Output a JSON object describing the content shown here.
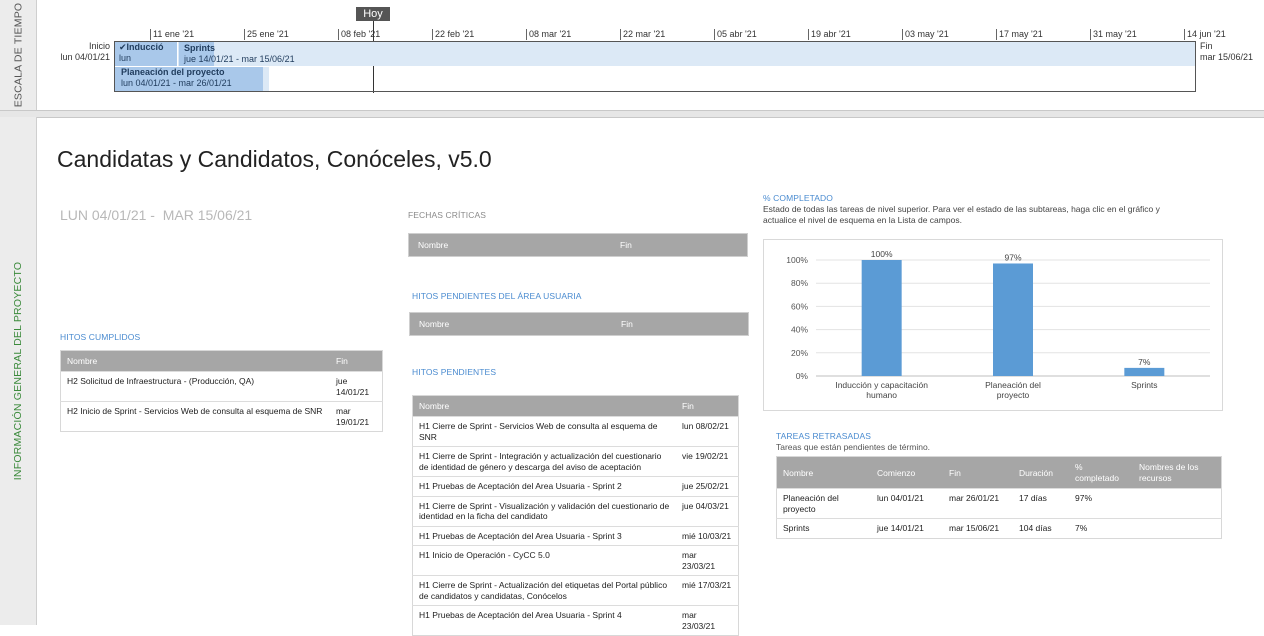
{
  "timeline": {
    "side_label": "ESCALA DE TIEMPO",
    "today_label": "Hoy",
    "ticks": [
      "11 ene '21",
      "25 ene '21",
      "08 feb '21",
      "22 feb '21",
      "08 mar '21",
      "22 mar '21",
      "05 abr '21",
      "19 abr '21",
      "03 may '21",
      "17 may '21",
      "31 may '21",
      "14 jun '21"
    ],
    "start_label": "Inicio",
    "start_date": "lun 04/01/21",
    "end_label": "Fin",
    "end_date": "mar 15/06/21",
    "bars": [
      {
        "name": "✔Inducció",
        "date": "lun"
      },
      {
        "name": "Sprints",
        "date": "jue 14/01/21 - mar 15/06/21"
      },
      {
        "name": "Planeación del proyecto",
        "date": "lun 04/01/21 - mar 26/01/21"
      }
    ]
  },
  "overview": {
    "side_label": "INFORMACIÓN GENERAL DEL PROYECTO",
    "title": "Candidatas y Candidatos, Conóceles, v5.0",
    "date_range": "LUN 04/01/21 -  MAR 15/06/21"
  },
  "hitos_cumplidos": {
    "title": "HITOS CUMPLIDOS",
    "headers": [
      "Nombre",
      "Fin"
    ],
    "rows": [
      [
        "H2 Solicitud de Infraestructura - (Producción, QA)",
        "jue 14/01/21"
      ],
      [
        "H2 Inicio de Sprint - Servicios Web de consulta al esquema de SNR",
        "mar 19/01/21"
      ]
    ]
  },
  "fechas_criticas": {
    "title": "FECHAS CRÍTICAS",
    "headers": [
      "Nombre",
      "Fin"
    ]
  },
  "hitos_area": {
    "title": "HITOS PENDIENTES DEL ÁREA USUARIA",
    "headers": [
      "Nombre",
      "Fin"
    ]
  },
  "hitos_pendientes": {
    "title": "HITOS PENDIENTES",
    "headers": [
      "Nombre",
      "Fin"
    ],
    "rows": [
      [
        "H1 Cierre de Sprint - Servicios Web de consulta al esquema de SNR",
        "lun 08/02/21"
      ],
      [
        "H1 Cierre de Sprint - Integración y actualización del cuestionario de identidad de género y descarga del aviso de aceptación",
        "vie 19/02/21"
      ],
      [
        "H1 Pruebas de Aceptación del Area Usuaria - Sprint 2",
        "jue 25/02/21"
      ],
      [
        "H1 Cierre de Sprint - Visualización y validación del cuestionario de identidad en la ficha del candidato",
        "jue 04/03/21"
      ],
      [
        "H1 Pruebas de Aceptación del Area Usuaria - Sprint 3",
        "mié 10/03/21"
      ],
      [
        "H1 Inicio de Operación - CyCC 5.0",
        "mar 23/03/21"
      ],
      [
        "H1 Cierre de Sprint - Actualización del etiquetas del Portal público de candidatos y candidatas, Conócelos",
        "mié 17/03/21"
      ],
      [
        "H1 Pruebas de Aceptación del Area Usuaria - Sprint 4",
        "mar 23/03/21"
      ]
    ]
  },
  "completado": {
    "title": "% COMPLETADO",
    "description": "Estado de todas las tareas de nivel superior. Para ver el estado de las subtareas, haga clic en el gráfico y actualice el nivel de esquema en la Lista de campos."
  },
  "chart_data": {
    "type": "bar",
    "categories": [
      "Inducción y capacitación humano",
      "Planeación del proyecto",
      "Sprints"
    ],
    "values": [
      100,
      97,
      7
    ],
    "value_labels": [
      "100%",
      "97%",
      "7%"
    ],
    "y_ticks": [
      "0%",
      "20%",
      "40%",
      "60%",
      "80%",
      "100%"
    ],
    "ylim": [
      0,
      100
    ],
    "grid": true,
    "bar_color": "#5b9bd5"
  },
  "retrasadas": {
    "title": "TAREAS RETRASADAS",
    "subtitle": "Tareas que están pendientes de término.",
    "headers": [
      "Nombre",
      "Comienzo",
      "Fin",
      "Duración",
      "% completado",
      "Nombres de los recursos"
    ],
    "rows": [
      [
        "Planeación del proyecto",
        "lun 04/01/21",
        "mar 26/01/21",
        "17 días",
        "97%",
        ""
      ],
      [
        "Sprints",
        "jue 14/01/21",
        "mar 15/06/21",
        "104 días",
        "7%",
        ""
      ]
    ]
  },
  "colors": {
    "accent": "#4a8bd0",
    "header_gray": "#a6a6a6",
    "bar_light": "#dce9f6",
    "bar_mid": "#a9c8ea"
  }
}
